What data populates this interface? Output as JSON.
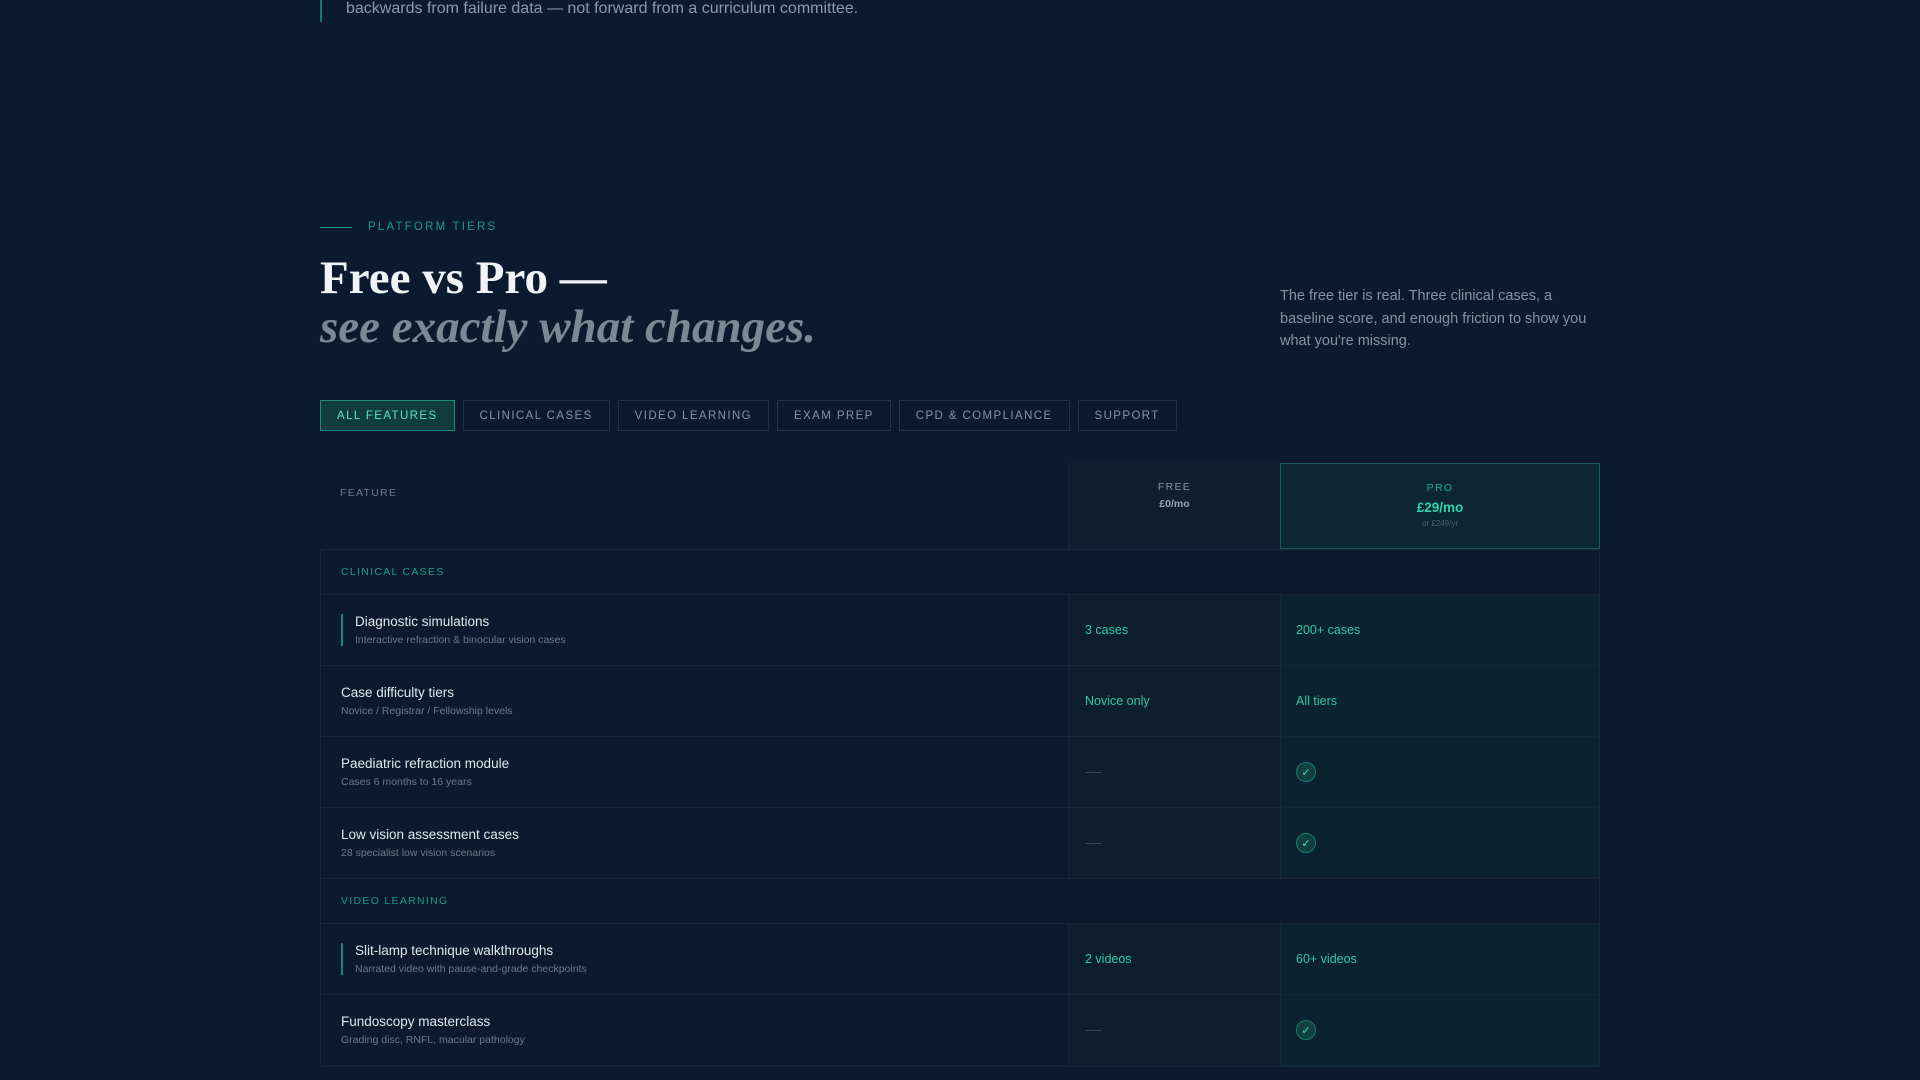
{
  "intro_quote": "backwards from failure data — not forward from a curriculum committee.",
  "eyebrow": "PLATFORM TIERS",
  "title": "Free vs Pro —",
  "subtitle": "see exactly what changes.",
  "intro": "The free tier is real. Three clinical cases, a baseline score, and enough friction to show you what you're missing.",
  "tabs": [
    "ALL FEATURES",
    "CLINICAL CASES",
    "VIDEO LEARNING",
    "EXAM PREP",
    "CPD & COMPLIANCE",
    "SUPPORT"
  ],
  "active_tab": "ALL FEATURES",
  "table": {
    "feature_header": "FEATURE",
    "free": {
      "name": "FREE",
      "price": "£0/mo"
    },
    "pro": {
      "name": "PRO",
      "price": "£29/mo",
      "alt": "or £249/yr"
    }
  },
  "sections": [
    {
      "label": "CLINICAL CASES",
      "rows": [
        {
          "name": "Diagnostic simulations",
          "desc": "Interactive refraction & binocular vision cases",
          "free": "3 cases",
          "pro": "200+ cases",
          "highlight": true
        },
        {
          "name": "Case difficulty tiers",
          "desc": "Novice / Registrar / Fellowship levels",
          "free": "Novice only",
          "pro": "All tiers",
          "highlight": false
        },
        {
          "name": "Paediatric refraction module",
          "desc": "Cases 6 months to 16 years",
          "free": null,
          "pro": "check",
          "highlight": false
        },
        {
          "name": "Low vision assessment cases",
          "desc": "28 specialist low vision scenarios",
          "free": null,
          "pro": "check",
          "highlight": false
        }
      ]
    },
    {
      "label": "VIDEO LEARNING",
      "rows": [
        {
          "name": "Slit-lamp technique walkthroughs",
          "desc": "Narrated video with pause-and-grade checkpoints",
          "free": "2 videos",
          "pro": "60+ videos",
          "highlight": true
        },
        {
          "name": "Fundoscopy masterclass",
          "desc": "Grading disc, RNFL, macular pathology",
          "free": null,
          "pro": "check",
          "highlight": false
        }
      ]
    }
  ],
  "icons": {
    "check": "check-icon",
    "unavailable": "dash-icon"
  },
  "colors": {
    "background": "#0b1a2e",
    "accent": "#1e9a84",
    "pro_price": "#2fd3ad"
  }
}
